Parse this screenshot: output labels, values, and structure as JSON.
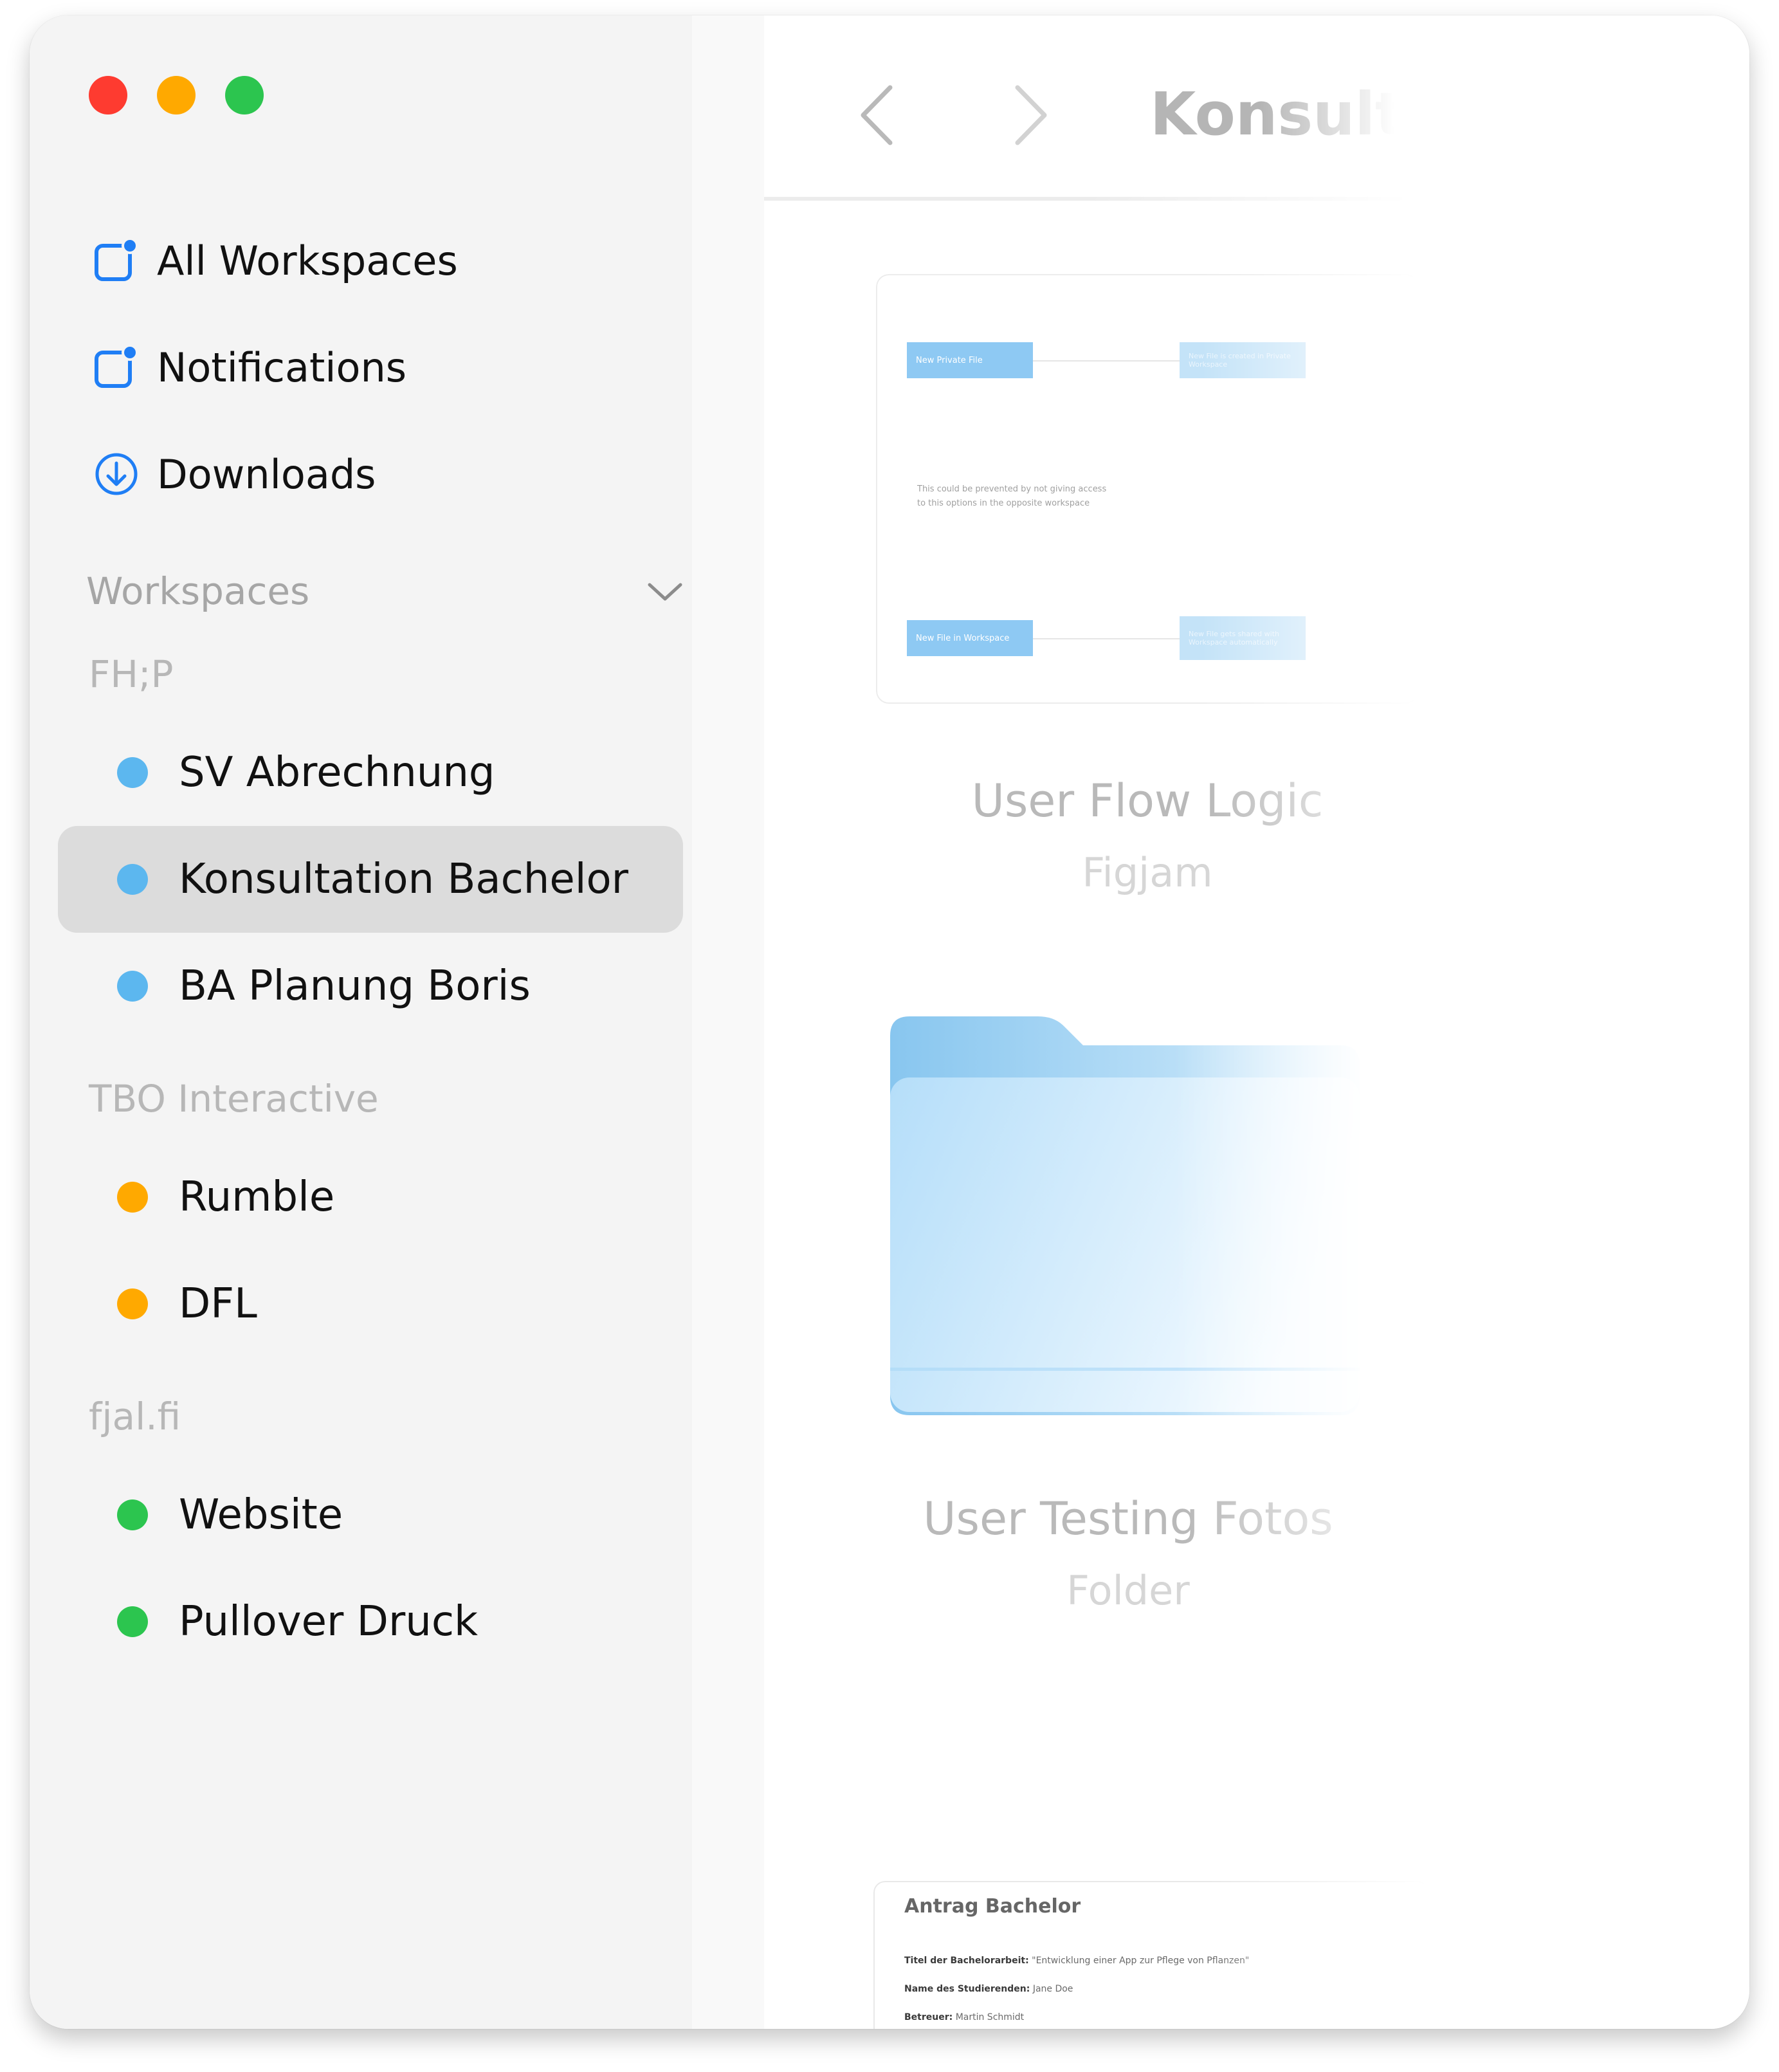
{
  "colors": {
    "close": "#fe3b30",
    "minimize": "#ffa900",
    "zoom": "#2cc54f",
    "accent": "#1f7ef5",
    "group_fhp": "#5cb7ef",
    "group_tbo": "#ffa900",
    "group_fjal": "#2cc54f"
  },
  "sidebar": {
    "nav": [
      {
        "label": "All Workspaces",
        "icon": "workspaces-badge-icon"
      },
      {
        "label": "Notifications",
        "icon": "notifications-badge-icon"
      },
      {
        "label": "Downloads",
        "icon": "download-circle-icon"
      }
    ],
    "section_title": "Workspaces",
    "groups": [
      {
        "name": "FH;P",
        "items": [
          "SV Abrechnung",
          "Konsultation Bachelor",
          "BA Planung Boris"
        ]
      },
      {
        "name": "TBO Interactive",
        "items": [
          "Rumble",
          "DFL"
        ]
      },
      {
        "name": "fjal.fi",
        "items": [
          "Website",
          "Pullover Druck"
        ]
      }
    ],
    "selected_item": "Konsultation Bachelor"
  },
  "main": {
    "title": "Konsultat",
    "files": [
      {
        "name": "User Flow Logic",
        "type": "Figjam",
        "preview": {
          "box1": "New Private File",
          "box2": "New File is created in Private Workspace",
          "note_line1": "This could be prevented by not giving access",
          "note_line2": "to this options in the opposite workspace",
          "box3": "New File in Workspace",
          "box4": "New File gets shared with Workspace automatically"
        }
      },
      {
        "name": "User Testing Fotos",
        "type": "Folder"
      },
      {
        "name": "Antrag Bachelor",
        "preview": {
          "line1_label": "Titel der Bachelorarbeit:",
          "line1_value": "\"Entwicklung einer App zur Pflege von Pflanzen\"",
          "line2_label": "Name des Studierenden:",
          "line2_value": "Jane Doe",
          "line3_label": "Betreuer:",
          "line3_value": "Martin Schmidt"
        }
      }
    ]
  }
}
